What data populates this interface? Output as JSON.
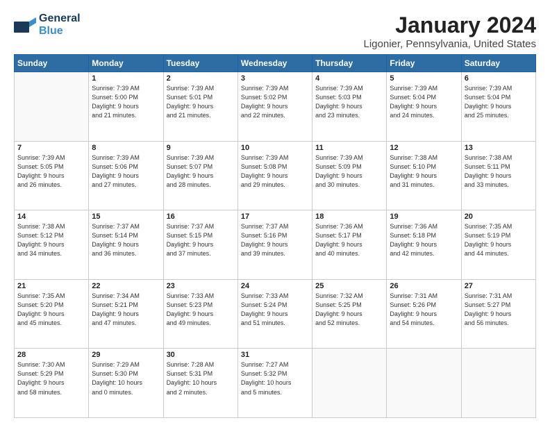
{
  "logo": {
    "line1": "General",
    "line2": "Blue"
  },
  "title": "January 2024",
  "location": "Ligonier, Pennsylvania, United States",
  "days_of_week": [
    "Sunday",
    "Monday",
    "Tuesday",
    "Wednesday",
    "Thursday",
    "Friday",
    "Saturday"
  ],
  "weeks": [
    [
      {
        "day": "",
        "info": ""
      },
      {
        "day": "1",
        "info": "Sunrise: 7:39 AM\nSunset: 5:00 PM\nDaylight: 9 hours\nand 21 minutes."
      },
      {
        "day": "2",
        "info": "Sunrise: 7:39 AM\nSunset: 5:01 PM\nDaylight: 9 hours\nand 21 minutes."
      },
      {
        "day": "3",
        "info": "Sunrise: 7:39 AM\nSunset: 5:02 PM\nDaylight: 9 hours\nand 22 minutes."
      },
      {
        "day": "4",
        "info": "Sunrise: 7:39 AM\nSunset: 5:03 PM\nDaylight: 9 hours\nand 23 minutes."
      },
      {
        "day": "5",
        "info": "Sunrise: 7:39 AM\nSunset: 5:04 PM\nDaylight: 9 hours\nand 24 minutes."
      },
      {
        "day": "6",
        "info": "Sunrise: 7:39 AM\nSunset: 5:04 PM\nDaylight: 9 hours\nand 25 minutes."
      }
    ],
    [
      {
        "day": "7",
        "info": "Sunrise: 7:39 AM\nSunset: 5:05 PM\nDaylight: 9 hours\nand 26 minutes."
      },
      {
        "day": "8",
        "info": "Sunrise: 7:39 AM\nSunset: 5:06 PM\nDaylight: 9 hours\nand 27 minutes."
      },
      {
        "day": "9",
        "info": "Sunrise: 7:39 AM\nSunset: 5:07 PM\nDaylight: 9 hours\nand 28 minutes."
      },
      {
        "day": "10",
        "info": "Sunrise: 7:39 AM\nSunset: 5:08 PM\nDaylight: 9 hours\nand 29 minutes."
      },
      {
        "day": "11",
        "info": "Sunrise: 7:39 AM\nSunset: 5:09 PM\nDaylight: 9 hours\nand 30 minutes."
      },
      {
        "day": "12",
        "info": "Sunrise: 7:38 AM\nSunset: 5:10 PM\nDaylight: 9 hours\nand 31 minutes."
      },
      {
        "day": "13",
        "info": "Sunrise: 7:38 AM\nSunset: 5:11 PM\nDaylight: 9 hours\nand 33 minutes."
      }
    ],
    [
      {
        "day": "14",
        "info": "Sunrise: 7:38 AM\nSunset: 5:12 PM\nDaylight: 9 hours\nand 34 minutes."
      },
      {
        "day": "15",
        "info": "Sunrise: 7:37 AM\nSunset: 5:14 PM\nDaylight: 9 hours\nand 36 minutes."
      },
      {
        "day": "16",
        "info": "Sunrise: 7:37 AM\nSunset: 5:15 PM\nDaylight: 9 hours\nand 37 minutes."
      },
      {
        "day": "17",
        "info": "Sunrise: 7:37 AM\nSunset: 5:16 PM\nDaylight: 9 hours\nand 39 minutes."
      },
      {
        "day": "18",
        "info": "Sunrise: 7:36 AM\nSunset: 5:17 PM\nDaylight: 9 hours\nand 40 minutes."
      },
      {
        "day": "19",
        "info": "Sunrise: 7:36 AM\nSunset: 5:18 PM\nDaylight: 9 hours\nand 42 minutes."
      },
      {
        "day": "20",
        "info": "Sunrise: 7:35 AM\nSunset: 5:19 PM\nDaylight: 9 hours\nand 44 minutes."
      }
    ],
    [
      {
        "day": "21",
        "info": "Sunrise: 7:35 AM\nSunset: 5:20 PM\nDaylight: 9 hours\nand 45 minutes."
      },
      {
        "day": "22",
        "info": "Sunrise: 7:34 AM\nSunset: 5:21 PM\nDaylight: 9 hours\nand 47 minutes."
      },
      {
        "day": "23",
        "info": "Sunrise: 7:33 AM\nSunset: 5:23 PM\nDaylight: 9 hours\nand 49 minutes."
      },
      {
        "day": "24",
        "info": "Sunrise: 7:33 AM\nSunset: 5:24 PM\nDaylight: 9 hours\nand 51 minutes."
      },
      {
        "day": "25",
        "info": "Sunrise: 7:32 AM\nSunset: 5:25 PM\nDaylight: 9 hours\nand 52 minutes."
      },
      {
        "day": "26",
        "info": "Sunrise: 7:31 AM\nSunset: 5:26 PM\nDaylight: 9 hours\nand 54 minutes."
      },
      {
        "day": "27",
        "info": "Sunrise: 7:31 AM\nSunset: 5:27 PM\nDaylight: 9 hours\nand 56 minutes."
      }
    ],
    [
      {
        "day": "28",
        "info": "Sunrise: 7:30 AM\nSunset: 5:29 PM\nDaylight: 9 hours\nand 58 minutes."
      },
      {
        "day": "29",
        "info": "Sunrise: 7:29 AM\nSunset: 5:30 PM\nDaylight: 10 hours\nand 0 minutes."
      },
      {
        "day": "30",
        "info": "Sunrise: 7:28 AM\nSunset: 5:31 PM\nDaylight: 10 hours\nand 2 minutes."
      },
      {
        "day": "31",
        "info": "Sunrise: 7:27 AM\nSunset: 5:32 PM\nDaylight: 10 hours\nand 5 minutes."
      },
      {
        "day": "",
        "info": ""
      },
      {
        "day": "",
        "info": ""
      },
      {
        "day": "",
        "info": ""
      }
    ]
  ]
}
